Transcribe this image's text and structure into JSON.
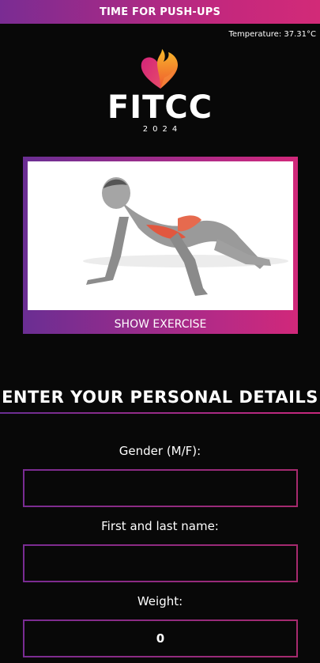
{
  "header": {
    "title": "TIME FOR PUSH-UPS"
  },
  "status": {
    "temperature": "Temperature: 37.31°C"
  },
  "logo": {
    "word": "FITCC",
    "year": "2024"
  },
  "exercise": {
    "button_label": "SHOW EXERCISE",
    "image": "push-up-illustration"
  },
  "form": {
    "heading": "ENTER YOUR PERSONAL DETAILS",
    "fields": [
      {
        "label": "Gender (M/F):",
        "value": ""
      },
      {
        "label": "First and last name:",
        "value": ""
      },
      {
        "label": "Weight:",
        "value": "0"
      }
    ]
  },
  "colors": {
    "accent_purple": "#7a2c93",
    "accent_pink": "#d22a78",
    "background": "#080808"
  }
}
